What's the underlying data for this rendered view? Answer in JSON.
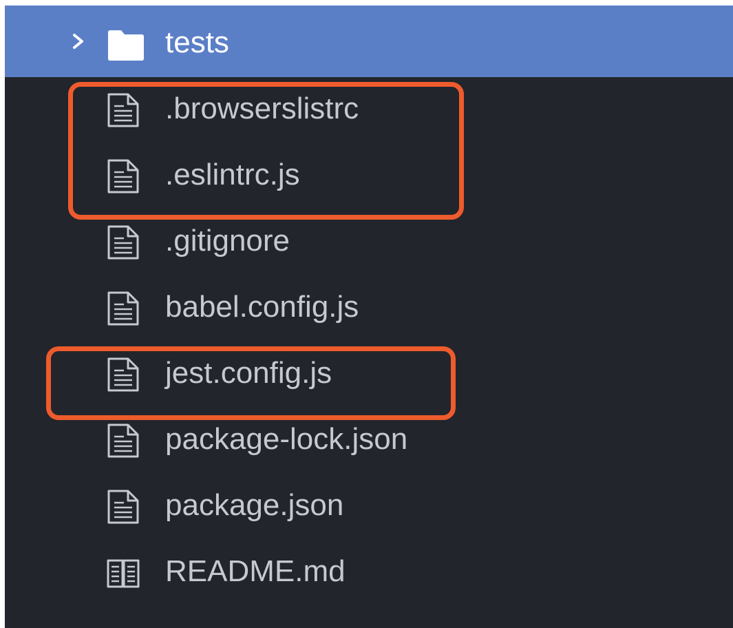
{
  "tree": {
    "folder": {
      "name": "tests",
      "icon": "folder-icon",
      "expander_icon": "chevron-right-icon"
    },
    "files": [
      {
        "name": ".browserslistrc",
        "icon": "file-text-icon"
      },
      {
        "name": ".eslintrc.js",
        "icon": "file-text-icon"
      },
      {
        "name": ".gitignore",
        "icon": "file-text-icon"
      },
      {
        "name": "babel.config.js",
        "icon": "file-text-icon"
      },
      {
        "name": "jest.config.js",
        "icon": "file-text-icon"
      },
      {
        "name": "package-lock.json",
        "icon": "file-text-icon"
      },
      {
        "name": "package.json",
        "icon": "file-text-icon"
      },
      {
        "name": "README.md",
        "icon": "book-icon"
      }
    ]
  },
  "annotations": {
    "color": "#ee5b2d",
    "highlighted_groups": [
      [
        ".browserslistrc",
        ".eslintrc.js"
      ],
      [
        "jest.config.js"
      ]
    ]
  },
  "colors": {
    "background": "#22252b",
    "selected_row": "#5b7fc7",
    "text": "#c5c9d1",
    "selected_text": "#ffffff"
  }
}
